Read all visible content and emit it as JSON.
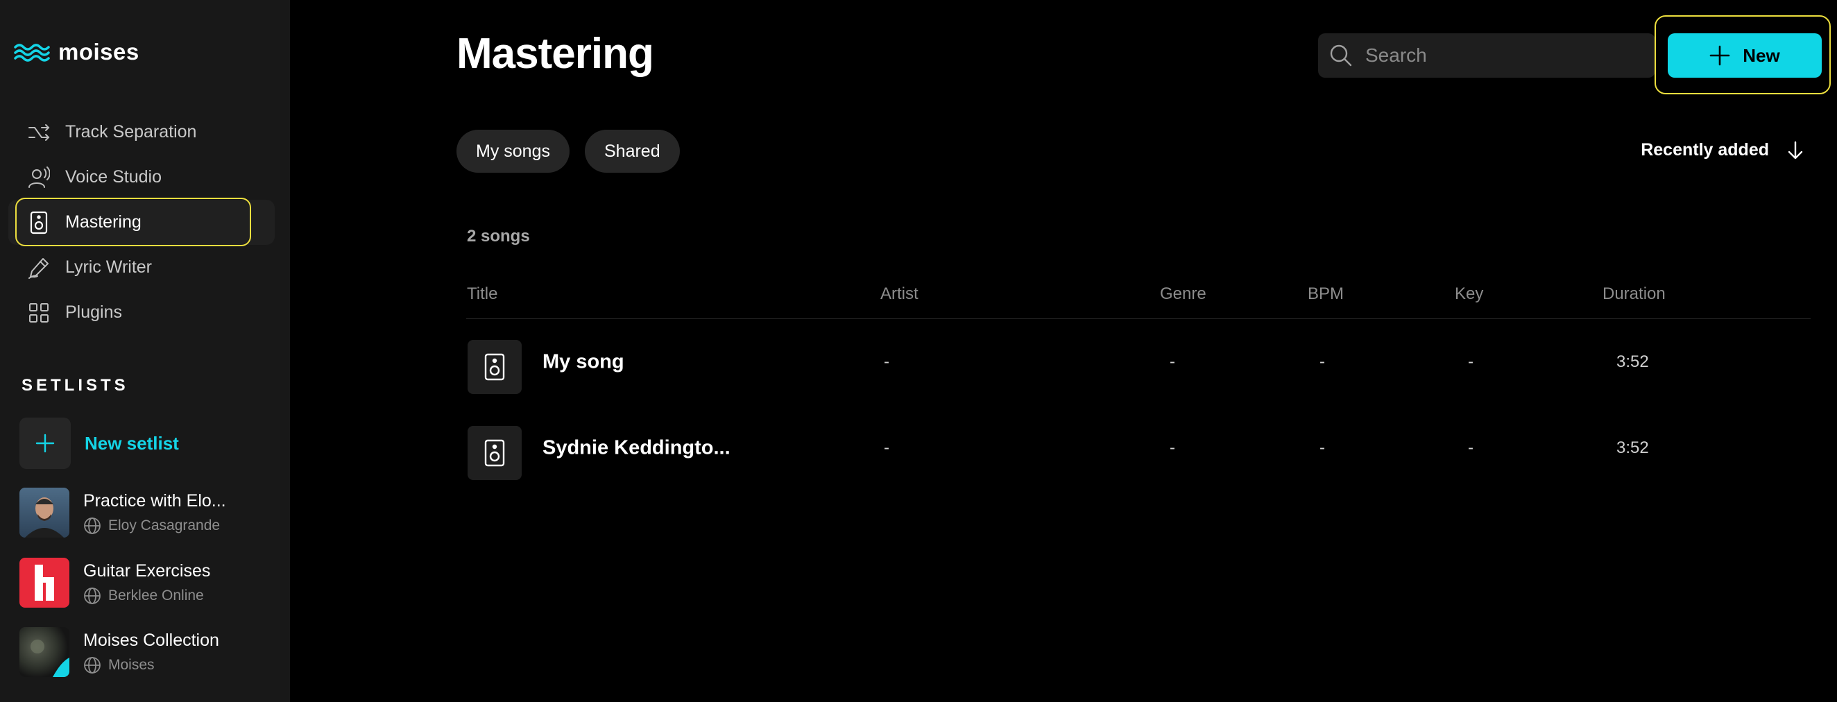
{
  "sidebar": {
    "logo_text": "moises",
    "nav": [
      {
        "label": "Track Separation",
        "icon": "shuffle-icon"
      },
      {
        "label": "Voice Studio",
        "icon": "voice-icon"
      },
      {
        "label": "Mastering",
        "icon": "speaker-icon",
        "active": true
      },
      {
        "label": "Lyric Writer",
        "icon": "pen-icon"
      },
      {
        "label": "Plugins",
        "icon": "grid-icon"
      }
    ],
    "setlists_heading": "SETLISTS",
    "new_setlist_label": "New setlist",
    "setlists": [
      {
        "name": "Practice with Elo...",
        "owner": "Eloy Casagrande"
      },
      {
        "name": "Guitar Exercises",
        "owner": "Berklee Online"
      },
      {
        "name": "Moises Collection",
        "owner": "Moises"
      }
    ]
  },
  "main": {
    "title": "Mastering",
    "search_placeholder": "Search",
    "new_button_label": "New",
    "filters": [
      "My songs",
      "Shared"
    ],
    "sort_label": "Recently added",
    "song_count": "2 songs",
    "columns": {
      "title": "Title",
      "artist": "Artist",
      "genre": "Genre",
      "bpm": "BPM",
      "key": "Key",
      "duration": "Duration"
    },
    "songs": [
      {
        "title": "My song",
        "artist": "-",
        "genre": "-",
        "bpm": "-",
        "key": "-",
        "duration": "3:52"
      },
      {
        "title": "Sydnie Keddingto...",
        "artist": "-",
        "genre": "-",
        "bpm": "-",
        "key": "-",
        "duration": "3:52"
      }
    ]
  },
  "colors": {
    "accent": "#0fd6e6",
    "highlight_ring": "#ecde3e",
    "sidebar_bg": "#181818",
    "background": "#000000"
  }
}
